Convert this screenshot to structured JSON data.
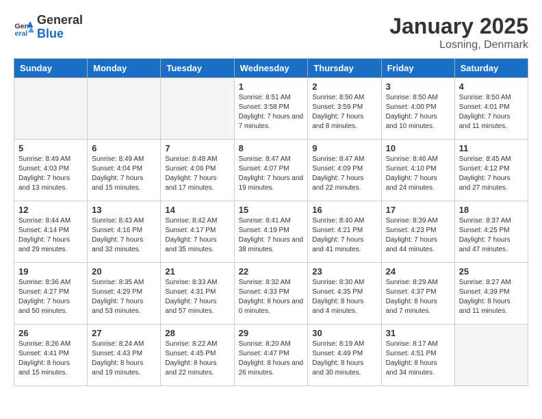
{
  "header": {
    "logo_general": "General",
    "logo_blue": "Blue",
    "month": "January 2025",
    "location": "Losning, Denmark"
  },
  "days_of_week": [
    "Sunday",
    "Monday",
    "Tuesday",
    "Wednesday",
    "Thursday",
    "Friday",
    "Saturday"
  ],
  "weeks": [
    [
      {
        "day": "",
        "sunrise": "",
        "sunset": "",
        "daylight": "",
        "empty": true
      },
      {
        "day": "",
        "sunrise": "",
        "sunset": "",
        "daylight": "",
        "empty": true
      },
      {
        "day": "",
        "sunrise": "",
        "sunset": "",
        "daylight": "",
        "empty": true
      },
      {
        "day": "1",
        "sunrise": "Sunrise: 8:51 AM",
        "sunset": "Sunset: 3:58 PM",
        "daylight": "Daylight: 7 hours and 7 minutes.",
        "empty": false
      },
      {
        "day": "2",
        "sunrise": "Sunrise: 8:50 AM",
        "sunset": "Sunset: 3:59 PM",
        "daylight": "Daylight: 7 hours and 8 minutes.",
        "empty": false
      },
      {
        "day": "3",
        "sunrise": "Sunrise: 8:50 AM",
        "sunset": "Sunset: 4:00 PM",
        "daylight": "Daylight: 7 hours and 10 minutes.",
        "empty": false
      },
      {
        "day": "4",
        "sunrise": "Sunrise: 8:50 AM",
        "sunset": "Sunset: 4:01 PM",
        "daylight": "Daylight: 7 hours and 11 minutes.",
        "empty": false
      }
    ],
    [
      {
        "day": "5",
        "sunrise": "Sunrise: 8:49 AM",
        "sunset": "Sunset: 4:03 PM",
        "daylight": "Daylight: 7 hours and 13 minutes.",
        "empty": false
      },
      {
        "day": "6",
        "sunrise": "Sunrise: 8:49 AM",
        "sunset": "Sunset: 4:04 PM",
        "daylight": "Daylight: 7 hours and 15 minutes.",
        "empty": false
      },
      {
        "day": "7",
        "sunrise": "Sunrise: 8:48 AM",
        "sunset": "Sunset: 4:06 PM",
        "daylight": "Daylight: 7 hours and 17 minutes.",
        "empty": false
      },
      {
        "day": "8",
        "sunrise": "Sunrise: 8:47 AM",
        "sunset": "Sunset: 4:07 PM",
        "daylight": "Daylight: 7 hours and 19 minutes.",
        "empty": false
      },
      {
        "day": "9",
        "sunrise": "Sunrise: 8:47 AM",
        "sunset": "Sunset: 4:09 PM",
        "daylight": "Daylight: 7 hours and 22 minutes.",
        "empty": false
      },
      {
        "day": "10",
        "sunrise": "Sunrise: 8:46 AM",
        "sunset": "Sunset: 4:10 PM",
        "daylight": "Daylight: 7 hours and 24 minutes.",
        "empty": false
      },
      {
        "day": "11",
        "sunrise": "Sunrise: 8:45 AM",
        "sunset": "Sunset: 4:12 PM",
        "daylight": "Daylight: 7 hours and 27 minutes.",
        "empty": false
      }
    ],
    [
      {
        "day": "12",
        "sunrise": "Sunrise: 8:44 AM",
        "sunset": "Sunset: 4:14 PM",
        "daylight": "Daylight: 7 hours and 29 minutes.",
        "empty": false
      },
      {
        "day": "13",
        "sunrise": "Sunrise: 8:43 AM",
        "sunset": "Sunset: 4:16 PM",
        "daylight": "Daylight: 7 hours and 32 minutes.",
        "empty": false
      },
      {
        "day": "14",
        "sunrise": "Sunrise: 8:42 AM",
        "sunset": "Sunset: 4:17 PM",
        "daylight": "Daylight: 7 hours and 35 minutes.",
        "empty": false
      },
      {
        "day": "15",
        "sunrise": "Sunrise: 8:41 AM",
        "sunset": "Sunset: 4:19 PM",
        "daylight": "Daylight: 7 hours and 38 minutes.",
        "empty": false
      },
      {
        "day": "16",
        "sunrise": "Sunrise: 8:40 AM",
        "sunset": "Sunset: 4:21 PM",
        "daylight": "Daylight: 7 hours and 41 minutes.",
        "empty": false
      },
      {
        "day": "17",
        "sunrise": "Sunrise: 8:39 AM",
        "sunset": "Sunset: 4:23 PM",
        "daylight": "Daylight: 7 hours and 44 minutes.",
        "empty": false
      },
      {
        "day": "18",
        "sunrise": "Sunrise: 8:37 AM",
        "sunset": "Sunset: 4:25 PM",
        "daylight": "Daylight: 7 hours and 47 minutes.",
        "empty": false
      }
    ],
    [
      {
        "day": "19",
        "sunrise": "Sunrise: 8:36 AM",
        "sunset": "Sunset: 4:27 PM",
        "daylight": "Daylight: 7 hours and 50 minutes.",
        "empty": false
      },
      {
        "day": "20",
        "sunrise": "Sunrise: 8:35 AM",
        "sunset": "Sunset: 4:29 PM",
        "daylight": "Daylight: 7 hours and 53 minutes.",
        "empty": false
      },
      {
        "day": "21",
        "sunrise": "Sunrise: 8:33 AM",
        "sunset": "Sunset: 4:31 PM",
        "daylight": "Daylight: 7 hours and 57 minutes.",
        "empty": false
      },
      {
        "day": "22",
        "sunrise": "Sunrise: 8:32 AM",
        "sunset": "Sunset: 4:33 PM",
        "daylight": "Daylight: 8 hours and 0 minutes.",
        "empty": false
      },
      {
        "day": "23",
        "sunrise": "Sunrise: 8:30 AM",
        "sunset": "Sunset: 4:35 PM",
        "daylight": "Daylight: 8 hours and 4 minutes.",
        "empty": false
      },
      {
        "day": "24",
        "sunrise": "Sunrise: 8:29 AM",
        "sunset": "Sunset: 4:37 PM",
        "daylight": "Daylight: 8 hours and 7 minutes.",
        "empty": false
      },
      {
        "day": "25",
        "sunrise": "Sunrise: 8:27 AM",
        "sunset": "Sunset: 4:39 PM",
        "daylight": "Daylight: 8 hours and 11 minutes.",
        "empty": false
      }
    ],
    [
      {
        "day": "26",
        "sunrise": "Sunrise: 8:26 AM",
        "sunset": "Sunset: 4:41 PM",
        "daylight": "Daylight: 8 hours and 15 minutes.",
        "empty": false
      },
      {
        "day": "27",
        "sunrise": "Sunrise: 8:24 AM",
        "sunset": "Sunset: 4:43 PM",
        "daylight": "Daylight: 8 hours and 19 minutes.",
        "empty": false
      },
      {
        "day": "28",
        "sunrise": "Sunrise: 8:22 AM",
        "sunset": "Sunset: 4:45 PM",
        "daylight": "Daylight: 8 hours and 22 minutes.",
        "empty": false
      },
      {
        "day": "29",
        "sunrise": "Sunrise: 8:20 AM",
        "sunset": "Sunset: 4:47 PM",
        "daylight": "Daylight: 8 hours and 26 minutes.",
        "empty": false
      },
      {
        "day": "30",
        "sunrise": "Sunrise: 8:19 AM",
        "sunset": "Sunset: 4:49 PM",
        "daylight": "Daylight: 8 hours and 30 minutes.",
        "empty": false
      },
      {
        "day": "31",
        "sunrise": "Sunrise: 8:17 AM",
        "sunset": "Sunset: 4:51 PM",
        "daylight": "Daylight: 8 hours and 34 minutes.",
        "empty": false
      },
      {
        "day": "",
        "sunrise": "",
        "sunset": "",
        "daylight": "",
        "empty": true
      }
    ]
  ]
}
